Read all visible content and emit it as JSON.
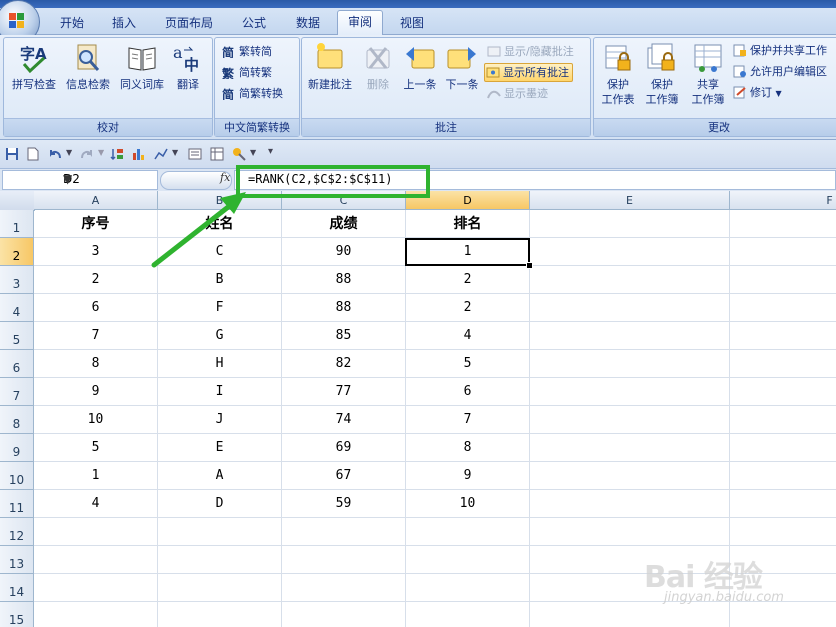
{
  "tabs": [
    "开始",
    "插入",
    "页面布局",
    "公式",
    "数据",
    "审阅",
    "视图"
  ],
  "active_tab": "审阅",
  "ribbon": {
    "proofing": {
      "label": "校对",
      "buttons": [
        "拼写检查",
        "信息检索",
        "同义词库",
        "翻译"
      ]
    },
    "chinese_conversion": {
      "label": "中文简繁转换",
      "buttons": [
        "繁转简",
        "简转繁",
        "简繁转换"
      ]
    },
    "comments": {
      "label": "批注",
      "buttons": [
        "新建批注",
        "删除",
        "上一条",
        "下一条"
      ],
      "small_buttons": [
        "显示/隐藏批注",
        "显示所有批注",
        "显示墨迹"
      ]
    },
    "changes": {
      "label": "更改",
      "buttons": [
        {
          "line1": "保护",
          "line2": "工作表"
        },
        {
          "line1": "保护",
          "line2": "工作簿"
        },
        {
          "line1": "共享",
          "line2": "工作簿"
        }
      ],
      "small_buttons": [
        "保护并共享工作",
        "允许用户编辑区",
        "修订"
      ]
    }
  },
  "name_box": "D2",
  "formula": "=RANK(C2,$C$2:$C$11)",
  "columns": [
    "A",
    "B",
    "C",
    "D",
    "E",
    "F"
  ],
  "rows": [
    "1",
    "2",
    "3",
    "4",
    "5",
    "6",
    "7",
    "8",
    "9",
    "10",
    "11",
    "12",
    "13",
    "14",
    "15"
  ],
  "table": {
    "headers": [
      "序号",
      "姓名",
      "成绩",
      "排名"
    ],
    "data": [
      [
        "3",
        "C",
        "90",
        "1"
      ],
      [
        "2",
        "B",
        "88",
        "2"
      ],
      [
        "6",
        "F",
        "88",
        "2"
      ],
      [
        "7",
        "G",
        "85",
        "4"
      ],
      [
        "8",
        "H",
        "82",
        "5"
      ],
      [
        "9",
        "I",
        "77",
        "6"
      ],
      [
        "10",
        "J",
        "74",
        "7"
      ],
      [
        "5",
        "E",
        "69",
        "8"
      ],
      [
        "1",
        "A",
        "67",
        "9"
      ],
      [
        "4",
        "D",
        "59",
        "10"
      ]
    ]
  },
  "selected_cell": {
    "col": "D",
    "row": "2"
  },
  "watermark": {
    "text": "Bai 经验",
    "url": "jingyan.baidu.com"
  },
  "colors": {
    "highlight": "#2fb32f",
    "ribbon": "#dce8f7",
    "selected_header": "#f7c765"
  }
}
